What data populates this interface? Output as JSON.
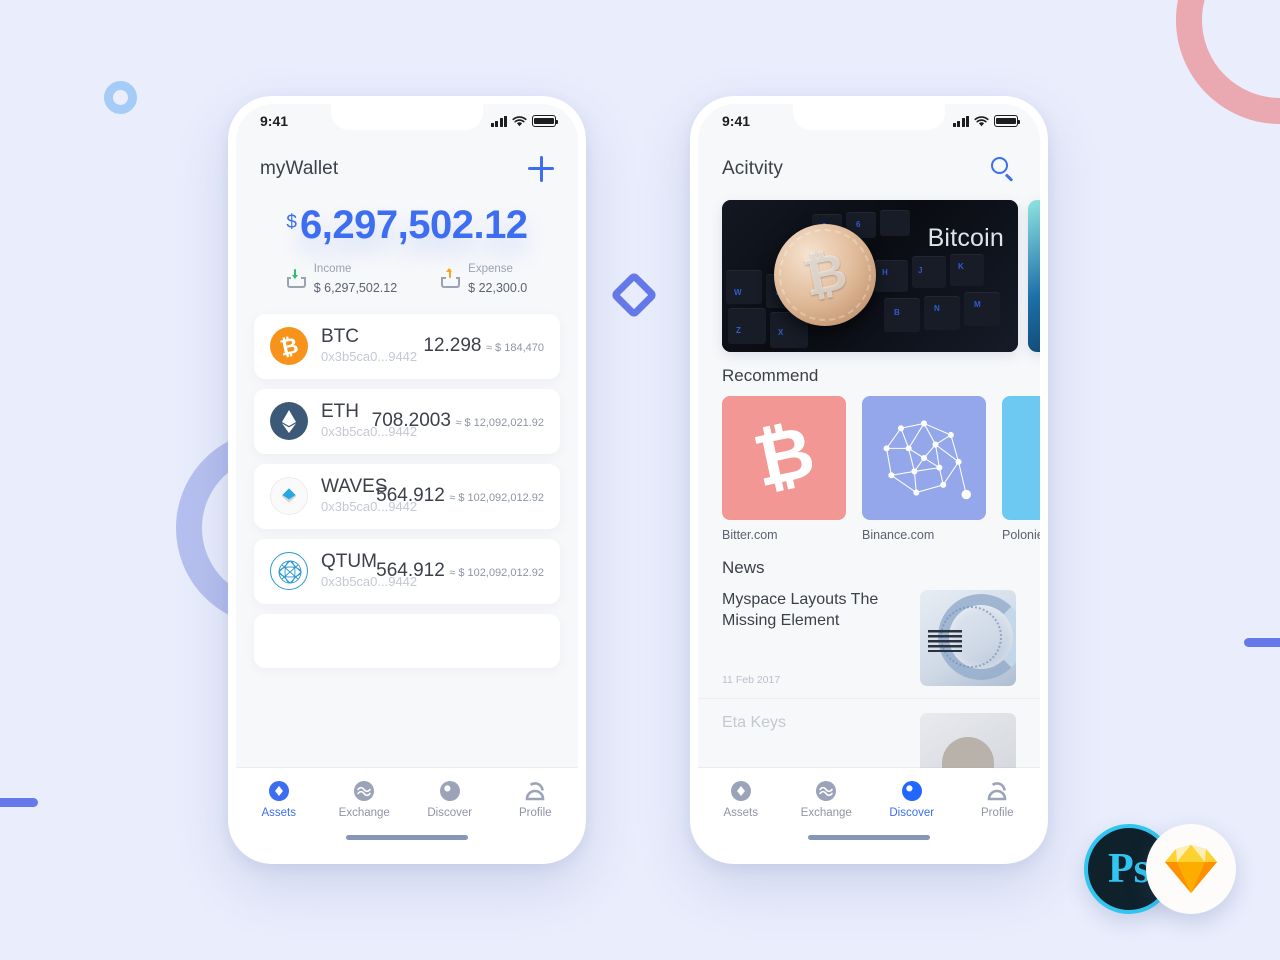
{
  "background": {
    "color": "#e9edfc",
    "decorations": [
      {
        "name": "pink-ring",
        "color": "#eaa8b0"
      },
      {
        "name": "purple-ring",
        "color": "#b6c0ef"
      },
      {
        "name": "blue-dot-ring",
        "color": "#a5ccf7"
      },
      {
        "name": "diamond-outline",
        "color": "#6579e8"
      },
      {
        "name": "bar-left",
        "color": "#6579e8"
      },
      {
        "name": "bar-right",
        "color": "#6579e8"
      }
    ]
  },
  "badges": {
    "photoshop": {
      "label": "Ps",
      "bg": "#0f212b",
      "ring": "#31c5f0",
      "text": "#31c5f0"
    },
    "sketch": {
      "label": "sketch-diamond-icon",
      "bg": "#ffffff",
      "top": "#fdd231",
      "mid": "#fdad00",
      "bottom": "#fdb300"
    }
  },
  "phone1": {
    "status": {
      "time": "9:41",
      "signal_icon": "cellular-signal-icon",
      "wifi_icon": "wifi-icon",
      "battery_icon": "battery-full-icon"
    },
    "appbar": {
      "title": "myWallet",
      "action_icon": "plus-icon"
    },
    "balance": {
      "currency": "$",
      "amount": "6,297,502.12",
      "color": "#3d6df0"
    },
    "summary": [
      {
        "icon": "income-arrow-down-icon",
        "label": "Income",
        "value": "$ 6,297,502.12",
        "accent": "#28c16b"
      },
      {
        "icon": "expense-arrow-up-icon",
        "label": "Expense",
        "value": "$ 22,300.0",
        "accent": "#f5a623"
      }
    ],
    "assets": [
      {
        "icon": "bitcoin-coin-icon",
        "symbol": "BTC",
        "address": "0x3b5ca0...9442",
        "amount": "12.298",
        "fiat": "≈ $ 184,470",
        "color": "#f7931a"
      },
      {
        "icon": "ethereum-coin-icon",
        "symbol": "ETH",
        "address": "0x3b5ca0...9442",
        "amount": "708.2003",
        "fiat": "≈ $ 12,092,021.92",
        "color": "#3c5a78"
      },
      {
        "icon": "waves-coin-icon",
        "symbol": "WAVES",
        "address": "0x3b5ca0...9442",
        "amount": "564.912",
        "fiat": "≈ $ 102,092,012.92",
        "color": "#28a8e0"
      },
      {
        "icon": "qtum-coin-icon",
        "symbol": "QTUM",
        "address": "0x3b5ca0...9442",
        "amount": "564.912",
        "fiat": "≈ $ 102,092,012.92",
        "color": "#2e9ad0"
      }
    ],
    "tabs": [
      {
        "icon": "assets-diamond-icon",
        "label": "Assets",
        "active": true
      },
      {
        "icon": "exchange-waves-icon",
        "label": "Exchange",
        "active": false
      },
      {
        "icon": "discover-compass-icon",
        "label": "Discover",
        "active": false
      },
      {
        "icon": "profile-person-icon",
        "label": "Profile",
        "active": false
      }
    ]
  },
  "phone2": {
    "status": {
      "time": "9:41",
      "signal_icon": "cellular-signal-icon",
      "wifi_icon": "wifi-icon",
      "battery_icon": "battery-full-icon"
    },
    "appbar": {
      "title": "Acitvity",
      "action_icon": "search-icon"
    },
    "banner": {
      "caption": "Bitcoin",
      "image": "bitcoin-coin-on-keyboard-photo"
    },
    "recommend": {
      "heading": "Recommend",
      "items": [
        {
          "icon": "bitcoin-logo-icon",
          "caption": "Bitter.com",
          "color": "#f29794"
        },
        {
          "icon": "binance-network-icon",
          "caption": "Binance.com",
          "color": "#93a7ea"
        },
        {
          "icon": "poloniex-logo-icon",
          "caption": "Polonie",
          "color": "#6ec9f2"
        }
      ]
    },
    "news": {
      "heading": "News",
      "items": [
        {
          "title": "Myspace Layouts The Missing Element",
          "date": "11 Feb 2017",
          "thumb": "ibm-server-photo"
        },
        {
          "title": "Eta Keys",
          "date": "",
          "thumb": "portrait-photo"
        }
      ]
    },
    "tabs": [
      {
        "icon": "assets-diamond-icon",
        "label": "Assets",
        "active": false
      },
      {
        "icon": "exchange-waves-icon",
        "label": "Exchange",
        "active": false
      },
      {
        "icon": "discover-compass-icon",
        "label": "Discover",
        "active": true
      },
      {
        "icon": "profile-person-icon",
        "label": "Profile",
        "active": false
      }
    ]
  }
}
